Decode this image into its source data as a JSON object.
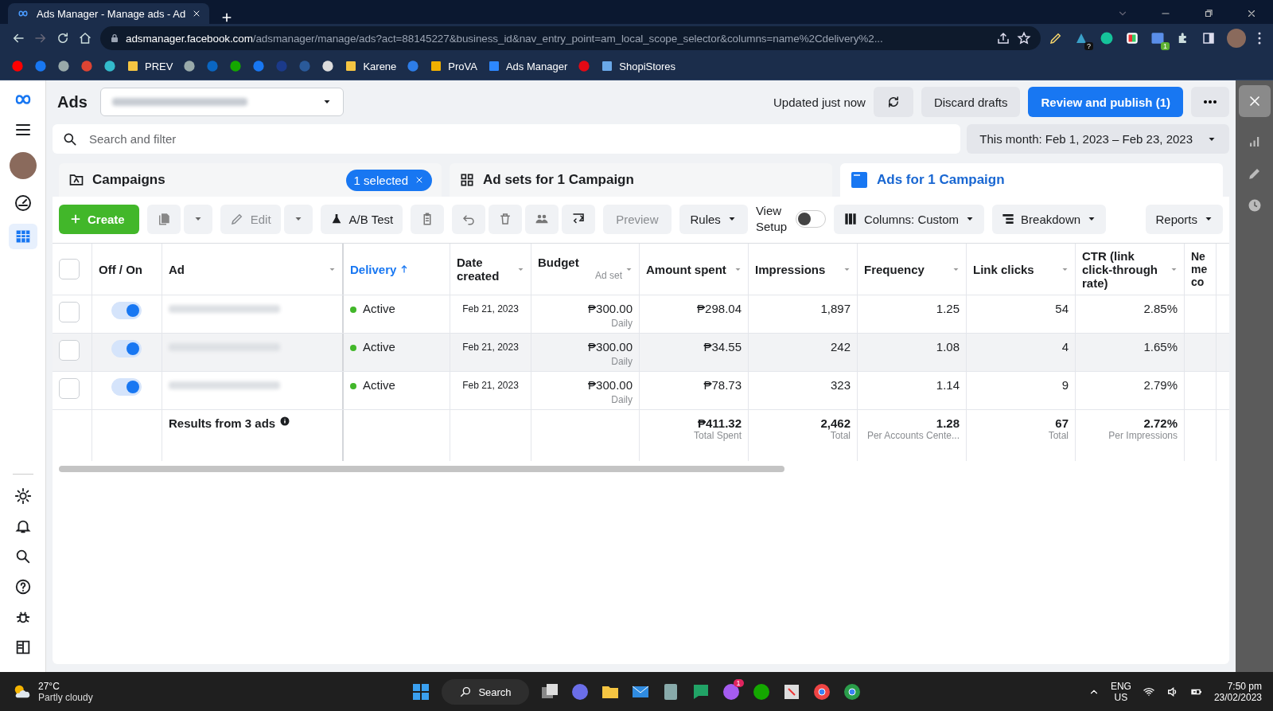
{
  "browser": {
    "tab_title": "Ads Manager - Manage ads - Ad",
    "url_host": "adsmanager.facebook.com",
    "url_path": "/adsmanager/manage/ads?act=88145227&business_id&nav_entry_point=am_local_scope_selector&columns=name%2Cdelivery%2...",
    "bookmarks": [
      {
        "label": "PREV"
      },
      {
        "label": "Karene"
      },
      {
        "label": "ProVA"
      },
      {
        "label": "Ads Manager"
      },
      {
        "label": "ShopiStores"
      }
    ],
    "extension_badges": [
      "?",
      "1"
    ]
  },
  "header": {
    "title": "Ads",
    "status": "Updated just now",
    "discard": "Discard drafts",
    "publish": "Review and publish (1)"
  },
  "search": {
    "placeholder": "Search and filter"
  },
  "date_range": "This month: Feb 1, 2023 – Feb 23, 2023",
  "level_tabs": [
    {
      "label": "Campaigns",
      "selected": false,
      "badge": "1 selected"
    },
    {
      "label": "Ad sets for 1 Campaign",
      "selected": false
    },
    {
      "label": "Ads for 1 Campaign",
      "selected": true
    }
  ],
  "toolbar": {
    "create": "Create",
    "edit": {
      "label": "Edit",
      "disabled": true
    },
    "ab_test": "A/B Test",
    "preview": {
      "label": "Preview",
      "disabled": true
    },
    "rules": "Rules",
    "view_setup": {
      "label": "View Setup",
      "on": false
    },
    "columns": "Columns: Custom",
    "breakdown": "Breakdown",
    "reports": "Reports"
  },
  "table": {
    "select_all_checked": false,
    "columns": [
      {
        "label": "Off / On"
      },
      {
        "label": "Ad"
      },
      {
        "label": "Delivery",
        "sorted": true
      },
      {
        "label": "Date created"
      },
      {
        "label": "Budget",
        "sublabel": "Ad set"
      },
      {
        "label": "Amount spent"
      },
      {
        "label": "Impressions"
      },
      {
        "label": "Frequency"
      },
      {
        "label": "Link clicks"
      },
      {
        "label": "CTR (link click-through rate)"
      },
      {
        "label": "Ne me co"
      }
    ],
    "rows": [
      {
        "checked": false,
        "on": true,
        "highlighted": false,
        "delivery": "Active",
        "color": "#42b72a",
        "date": "Feb 21, 2023",
        "budget": "₱300.00",
        "budget_period": "Daily",
        "amount": "₱298.04",
        "impressions": "1,897",
        "frequency": "1.25",
        "link_clicks": "54",
        "ctr": "2.85%"
      },
      {
        "checked": false,
        "on": true,
        "highlighted": true,
        "delivery": "Active",
        "color": "#42b72a",
        "date": "Feb 21, 2023",
        "budget": "₱300.00",
        "budget_period": "Daily",
        "amount": "₱34.55",
        "impressions": "242",
        "frequency": "1.08",
        "link_clicks": "4",
        "ctr": "1.65%"
      },
      {
        "checked": false,
        "on": true,
        "highlighted": false,
        "delivery": "Active",
        "color": "#42b72a",
        "date": "Feb 21, 2023",
        "budget": "₱300.00",
        "budget_period": "Daily",
        "amount": "₱78.73",
        "impressions": "323",
        "frequency": "1.14",
        "link_clicks": "9",
        "ctr": "2.79%"
      }
    ],
    "summary": {
      "label": "Results from 3 ads",
      "amount": "₱411.32",
      "amount_note": "Total Spent",
      "impressions": "2,462",
      "impressions_note": "Total",
      "frequency": "1.28",
      "frequency_note": "Per Accounts Cente...",
      "link_clicks": "67",
      "link_clicks_note": "Total",
      "ctr": "2.72%",
      "ctr_note": "Per Impressions"
    }
  },
  "taskbar": {
    "temperature": "27°C",
    "weather": "Partly cloudy",
    "search": "Search",
    "messenger_badge": "1",
    "language": "ENG",
    "region": "US",
    "time": "7:50 pm",
    "date": "23/02/2023"
  }
}
